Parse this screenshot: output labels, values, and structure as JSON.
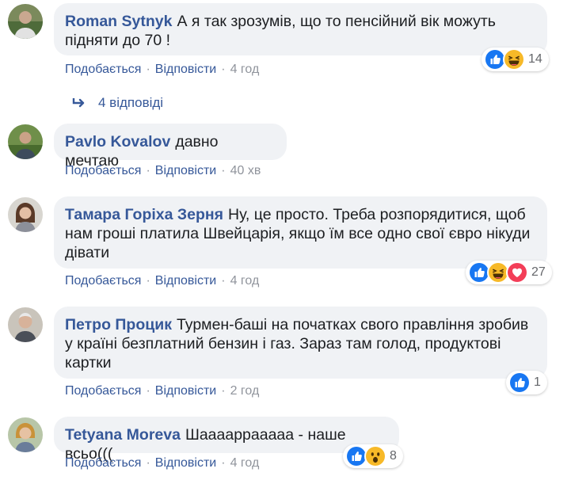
{
  "action_labels": {
    "like": "Подобається",
    "reply": "Відповісти"
  },
  "comments": [
    {
      "author": "Roman Sytnyk",
      "text": "А я так зрозумів, що то пенсійний вік можуть підняти до 70 !",
      "time": "4 год",
      "reaction_count": "14",
      "reactions": [
        "like-icon",
        "haha-icon"
      ]
    },
    {
      "author": "Pavlo Kovalov",
      "text": "давно мечтаю",
      "time": "40 хв"
    },
    {
      "author": "Тамара Горіха Зерня",
      "text": "Ну, це просто. Треба розпорядитися, щоб нам гроші платила Швейцарія, якщо їм все одно свої євро нікуди дівати",
      "time": "4 год",
      "reaction_count": "27",
      "reactions": [
        "like-icon",
        "haha-icon",
        "love-icon"
      ]
    },
    {
      "author": "Петро Процик",
      "text": "Турмен-баші на початках свого правління зробив у країні безплатний бензин і газ. Зараз там голод, продуктові картки",
      "time": "2 год",
      "reaction_count": "1",
      "reactions": [
        "like-icon"
      ]
    },
    {
      "author": "Tetyana Moreva",
      "text": "Шааааррааааа - наше всьо(((",
      "time": "4 год",
      "reaction_count": "8",
      "reactions": [
        "like-icon",
        "wow-icon"
      ]
    }
  ],
  "replies_link": "4 відповіді",
  "colors": {
    "link": "#365899",
    "bubble": "#f0f2f5",
    "like": "#1877f2",
    "love": "#f33e58",
    "emoji": "#f7b928"
  }
}
